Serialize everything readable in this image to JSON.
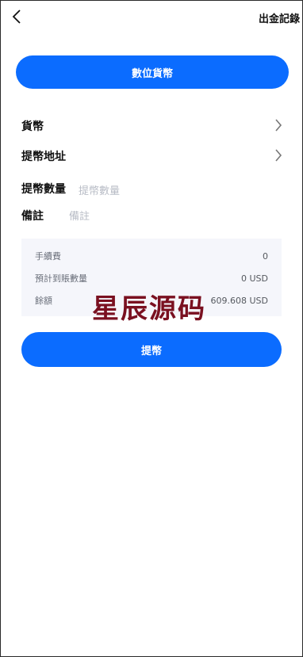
{
  "header": {
    "back_icon": "chevron-left-icon",
    "records_label": "出金記錄"
  },
  "type_button": {
    "label": "數位貨幣"
  },
  "form": {
    "currency": {
      "label": "貨幣",
      "icon": "chevron-right-icon"
    },
    "address": {
      "label": "提幣地址",
      "icon": "chevron-right-icon"
    },
    "amount": {
      "label": "提幣數量",
      "value": "",
      "placeholder": "提幣數量"
    },
    "remark": {
      "label": "備註",
      "value": "",
      "placeholder": "備註"
    }
  },
  "summary": {
    "fee": {
      "label": "手續費",
      "value": "0"
    },
    "estimated": {
      "label": "預計到賬數量",
      "value": "0 USD"
    },
    "balance": {
      "label": "餘額",
      "value": "609.608 USD"
    }
  },
  "watermark": {
    "text": "星辰源码"
  },
  "submit_button": {
    "label": "提幣"
  },
  "colors": {
    "accent": "#0b6cff",
    "summary_bg": "#f5f6fb",
    "watermark": "#7a1020"
  }
}
